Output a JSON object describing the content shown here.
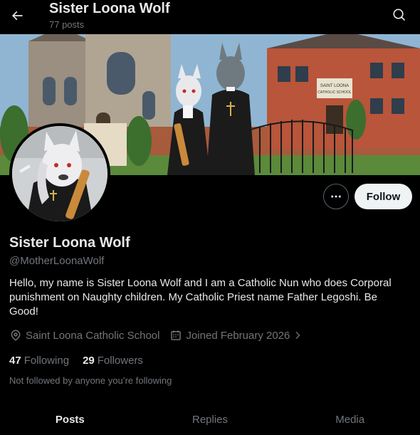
{
  "header": {
    "title": "Sister Loona Wolf",
    "post_count": "77 posts",
    "back_icon": "arrow-left-icon",
    "search_icon": "search-icon"
  },
  "banner": {
    "school_sign": "SAINT LOONA CATHOLIC SCHOOL",
    "partial_sign_text": "NA",
    "partial_sign_text2": "H"
  },
  "actions": {
    "more_icon": "more-horizontal-icon",
    "follow_label": "Follow"
  },
  "profile": {
    "display_name": "Sister Loona Wolf",
    "handle": "@MotherLoonaWolf",
    "bio": "Hello, my name is Sister Loona Wolf and I am a Catholic Nun who does Corporal punishment on Naughty children. My Catholic Priest name Father Legoshi. Be Good!",
    "location": "Saint Loona Catholic School",
    "joined": "Joined February 2026",
    "following_count": "47",
    "following_label": "Following",
    "followers_count": "29",
    "followers_label": "Followers",
    "not_followed_text": "Not followed by anyone you’re following"
  },
  "tabs": [
    {
      "label": "Posts",
      "active": true
    },
    {
      "label": "Replies",
      "active": false
    },
    {
      "label": "Media",
      "active": false
    }
  ],
  "colors": {
    "background": "#000000",
    "text_primary": "#e7e9ea",
    "text_secondary": "#71767b",
    "follow_button_bg": "#eff3f4",
    "accent": "#1d9bf0"
  }
}
